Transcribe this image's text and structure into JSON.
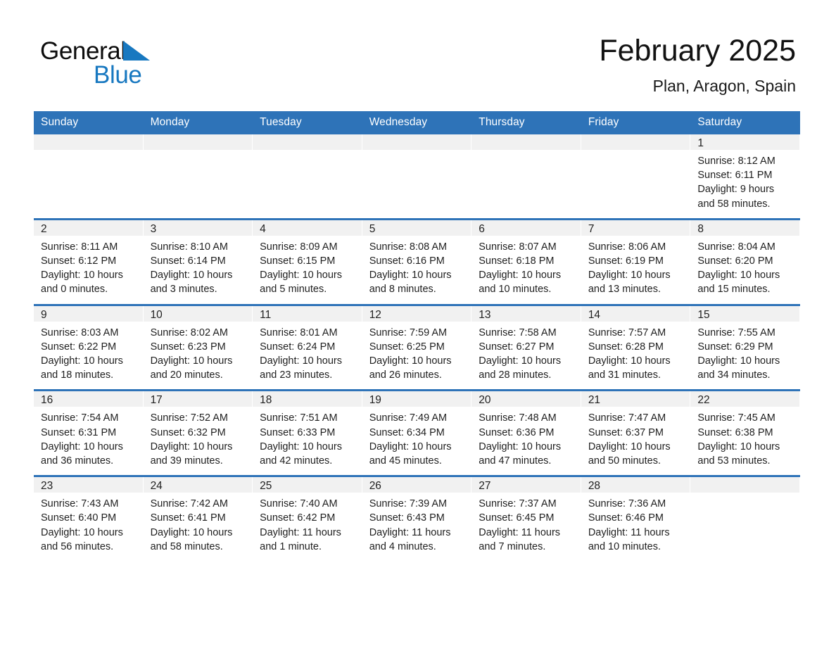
{
  "brand": {
    "name_part1": "General",
    "name_part2": "Blue",
    "accent_color": "#1878c0",
    "logo_icon": "triangle-flag-icon"
  },
  "header": {
    "title": "February 2025",
    "subtitle": "Plan, Aragon, Spain"
  },
  "theme": {
    "header_blue": "#2e73b8",
    "day_band_gray": "#f1f1f1",
    "text": "#1f1f1f"
  },
  "weekday_headers": [
    "Sunday",
    "Monday",
    "Tuesday",
    "Wednesday",
    "Thursday",
    "Friday",
    "Saturday"
  ],
  "weeks": [
    [
      {
        "day": "",
        "lines": []
      },
      {
        "day": "",
        "lines": []
      },
      {
        "day": "",
        "lines": []
      },
      {
        "day": "",
        "lines": []
      },
      {
        "day": "",
        "lines": []
      },
      {
        "day": "",
        "lines": []
      },
      {
        "day": "1",
        "lines": [
          "Sunrise: 8:12 AM",
          "Sunset: 6:11 PM",
          "Daylight: 9 hours",
          "and 58 minutes."
        ]
      }
    ],
    [
      {
        "day": "2",
        "lines": [
          "Sunrise: 8:11 AM",
          "Sunset: 6:12 PM",
          "Daylight: 10 hours",
          "and 0 minutes."
        ]
      },
      {
        "day": "3",
        "lines": [
          "Sunrise: 8:10 AM",
          "Sunset: 6:14 PM",
          "Daylight: 10 hours",
          "and 3 minutes."
        ]
      },
      {
        "day": "4",
        "lines": [
          "Sunrise: 8:09 AM",
          "Sunset: 6:15 PM",
          "Daylight: 10 hours",
          "and 5 minutes."
        ]
      },
      {
        "day": "5",
        "lines": [
          "Sunrise: 8:08 AM",
          "Sunset: 6:16 PM",
          "Daylight: 10 hours",
          "and 8 minutes."
        ]
      },
      {
        "day": "6",
        "lines": [
          "Sunrise: 8:07 AM",
          "Sunset: 6:18 PM",
          "Daylight: 10 hours",
          "and 10 minutes."
        ]
      },
      {
        "day": "7",
        "lines": [
          "Sunrise: 8:06 AM",
          "Sunset: 6:19 PM",
          "Daylight: 10 hours",
          "and 13 minutes."
        ]
      },
      {
        "day": "8",
        "lines": [
          "Sunrise: 8:04 AM",
          "Sunset: 6:20 PM",
          "Daylight: 10 hours",
          "and 15 minutes."
        ]
      }
    ],
    [
      {
        "day": "9",
        "lines": [
          "Sunrise: 8:03 AM",
          "Sunset: 6:22 PM",
          "Daylight: 10 hours",
          "and 18 minutes."
        ]
      },
      {
        "day": "10",
        "lines": [
          "Sunrise: 8:02 AM",
          "Sunset: 6:23 PM",
          "Daylight: 10 hours",
          "and 20 minutes."
        ]
      },
      {
        "day": "11",
        "lines": [
          "Sunrise: 8:01 AM",
          "Sunset: 6:24 PM",
          "Daylight: 10 hours",
          "and 23 minutes."
        ]
      },
      {
        "day": "12",
        "lines": [
          "Sunrise: 7:59 AM",
          "Sunset: 6:25 PM",
          "Daylight: 10 hours",
          "and 26 minutes."
        ]
      },
      {
        "day": "13",
        "lines": [
          "Sunrise: 7:58 AM",
          "Sunset: 6:27 PM",
          "Daylight: 10 hours",
          "and 28 minutes."
        ]
      },
      {
        "day": "14",
        "lines": [
          "Sunrise: 7:57 AM",
          "Sunset: 6:28 PM",
          "Daylight: 10 hours",
          "and 31 minutes."
        ]
      },
      {
        "day": "15",
        "lines": [
          "Sunrise: 7:55 AM",
          "Sunset: 6:29 PM",
          "Daylight: 10 hours",
          "and 34 minutes."
        ]
      }
    ],
    [
      {
        "day": "16",
        "lines": [
          "Sunrise: 7:54 AM",
          "Sunset: 6:31 PM",
          "Daylight: 10 hours",
          "and 36 minutes."
        ]
      },
      {
        "day": "17",
        "lines": [
          "Sunrise: 7:52 AM",
          "Sunset: 6:32 PM",
          "Daylight: 10 hours",
          "and 39 minutes."
        ]
      },
      {
        "day": "18",
        "lines": [
          "Sunrise: 7:51 AM",
          "Sunset: 6:33 PM",
          "Daylight: 10 hours",
          "and 42 minutes."
        ]
      },
      {
        "day": "19",
        "lines": [
          "Sunrise: 7:49 AM",
          "Sunset: 6:34 PM",
          "Daylight: 10 hours",
          "and 45 minutes."
        ]
      },
      {
        "day": "20",
        "lines": [
          "Sunrise: 7:48 AM",
          "Sunset: 6:36 PM",
          "Daylight: 10 hours",
          "and 47 minutes."
        ]
      },
      {
        "day": "21",
        "lines": [
          "Sunrise: 7:47 AM",
          "Sunset: 6:37 PM",
          "Daylight: 10 hours",
          "and 50 minutes."
        ]
      },
      {
        "day": "22",
        "lines": [
          "Sunrise: 7:45 AM",
          "Sunset: 6:38 PM",
          "Daylight: 10 hours",
          "and 53 minutes."
        ]
      }
    ],
    [
      {
        "day": "23",
        "lines": [
          "Sunrise: 7:43 AM",
          "Sunset: 6:40 PM",
          "Daylight: 10 hours",
          "and 56 minutes."
        ]
      },
      {
        "day": "24",
        "lines": [
          "Sunrise: 7:42 AM",
          "Sunset: 6:41 PM",
          "Daylight: 10 hours",
          "and 58 minutes."
        ]
      },
      {
        "day": "25",
        "lines": [
          "Sunrise: 7:40 AM",
          "Sunset: 6:42 PM",
          "Daylight: 11 hours",
          "and 1 minute."
        ]
      },
      {
        "day": "26",
        "lines": [
          "Sunrise: 7:39 AM",
          "Sunset: 6:43 PM",
          "Daylight: 11 hours",
          "and 4 minutes."
        ]
      },
      {
        "day": "27",
        "lines": [
          "Sunrise: 7:37 AM",
          "Sunset: 6:45 PM",
          "Daylight: 11 hours",
          "and 7 minutes."
        ]
      },
      {
        "day": "28",
        "lines": [
          "Sunrise: 7:36 AM",
          "Sunset: 6:46 PM",
          "Daylight: 11 hours",
          "and 10 minutes."
        ]
      },
      {
        "day": "",
        "lines": []
      }
    ]
  ]
}
